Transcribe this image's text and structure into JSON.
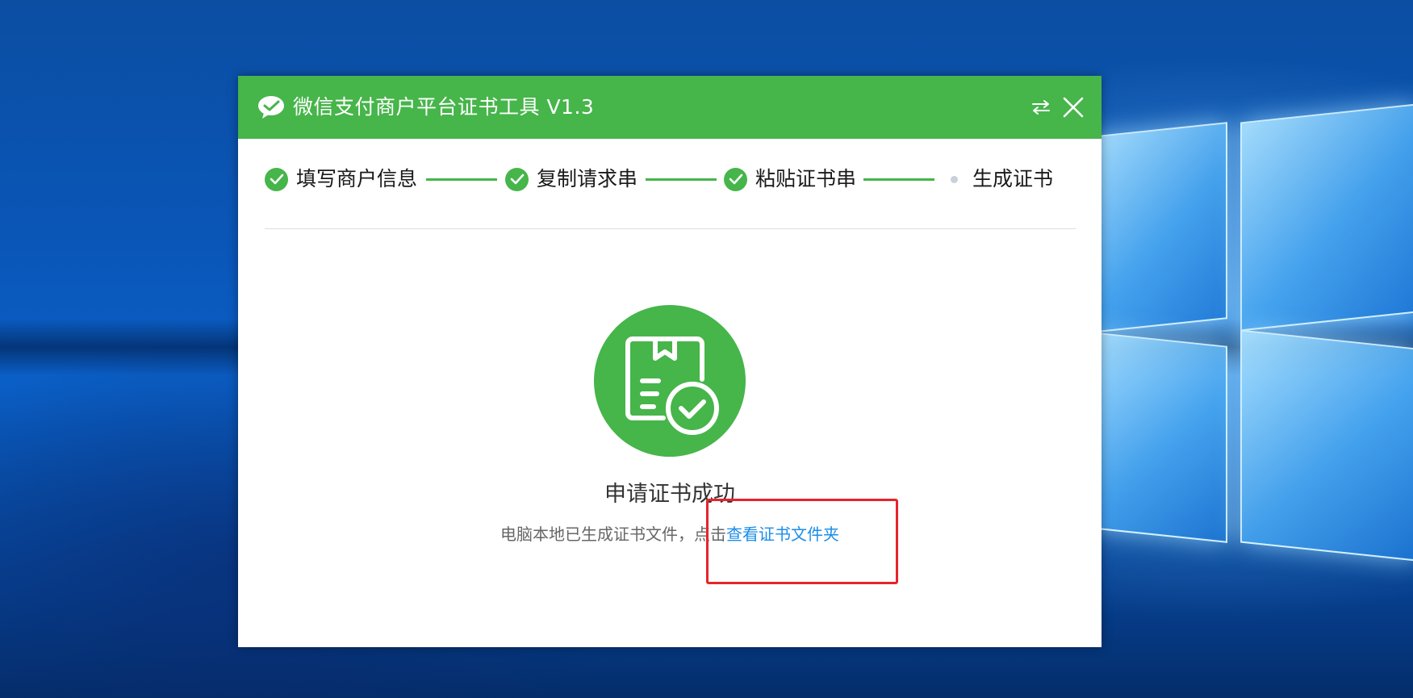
{
  "window": {
    "title": "微信支付商户平台证书工具 V1.3",
    "logo_icon": "wechat-pay-logo-icon",
    "switch_icon": "switch-icon",
    "close_icon": "close-icon"
  },
  "steps": [
    {
      "label": "填写商户信息",
      "state": "done"
    },
    {
      "label": "复制请求串",
      "state": "done"
    },
    {
      "label": "粘贴证书串",
      "state": "done"
    },
    {
      "label": "生成证书",
      "state": "current"
    }
  ],
  "result": {
    "icon": "certificate-success-icon",
    "title": "申请证书成功",
    "desc_prefix": "电脑本地已生成证书文件，点击",
    "link_label": "查看证书文件夹"
  },
  "colors": {
    "brand_green": "#46b54a",
    "link_blue": "#1a8ee8",
    "highlight_red": "#e8232a"
  }
}
